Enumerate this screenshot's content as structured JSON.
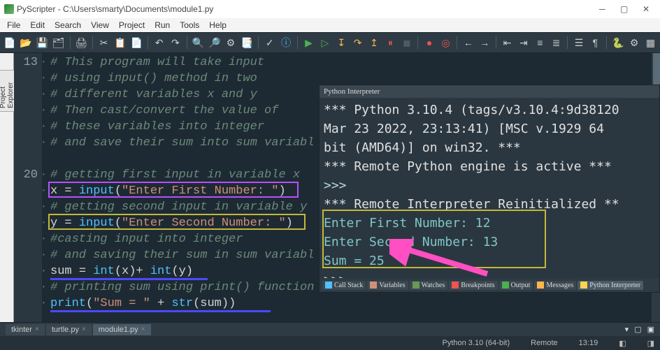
{
  "titlebar": {
    "app": "PyScripter",
    "path": "C:\\Users\\smarty\\Documents\\module1.py"
  },
  "menubar": [
    "File",
    "Edit",
    "Search",
    "View",
    "Project",
    "Run",
    "Tools",
    "Help"
  ],
  "sidebar": {
    "tab": "Project Explorer"
  },
  "gutter": {
    "start": 13,
    "shown": [
      13,
      20
    ]
  },
  "code": {
    "lines": [
      "# This program will take input",
      "# using input() method in two",
      "# different variables x and y",
      "# Then cast/convert the value of",
      "# these variables into integer",
      "# and save their sum into sum variabl",
      "",
      "# getting first input in variable x",
      "x = input(\"Enter First Number: \")",
      "# getting second input in variable y",
      "y = input(\"Enter Second Number: \")",
      "#casting input into integer",
      "# and saving their sum in sum variabl",
      "sum = int(x)+ int(y)",
      "# printing sum using print() function",
      "print(\"Sum = \" + str(sum))"
    ]
  },
  "interpreter": {
    "title": "Python Interpreter",
    "banner1": "*** Python 3.10.4 (tags/v3.10.4:9d38120",
    "banner2": " Mar 23 2022, 23:13:41) [MSC v.1929 64",
    "banner3": "bit (AMD64)] on win32. ***",
    "banner4": "*** Remote Python engine is active ***",
    "prompt": ">>>",
    "banner5": "***  Remote Interpreter Reinitialized **",
    "io1": "Enter First Number: 12",
    "io2": "Enter Second Number: 13",
    "io3": "Sum = 25"
  },
  "interp_tabs": [
    "Call Stack",
    "Variables",
    "Watches",
    "Breakpoints",
    "Output",
    "Messages",
    "Python Interpreter"
  ],
  "filetabs": [
    "tkinter",
    "turtle.py",
    "module1.py"
  ],
  "status": {
    "python": "Python 3.10 (64-bit)",
    "engine": "Remote",
    "time": "13:19"
  }
}
